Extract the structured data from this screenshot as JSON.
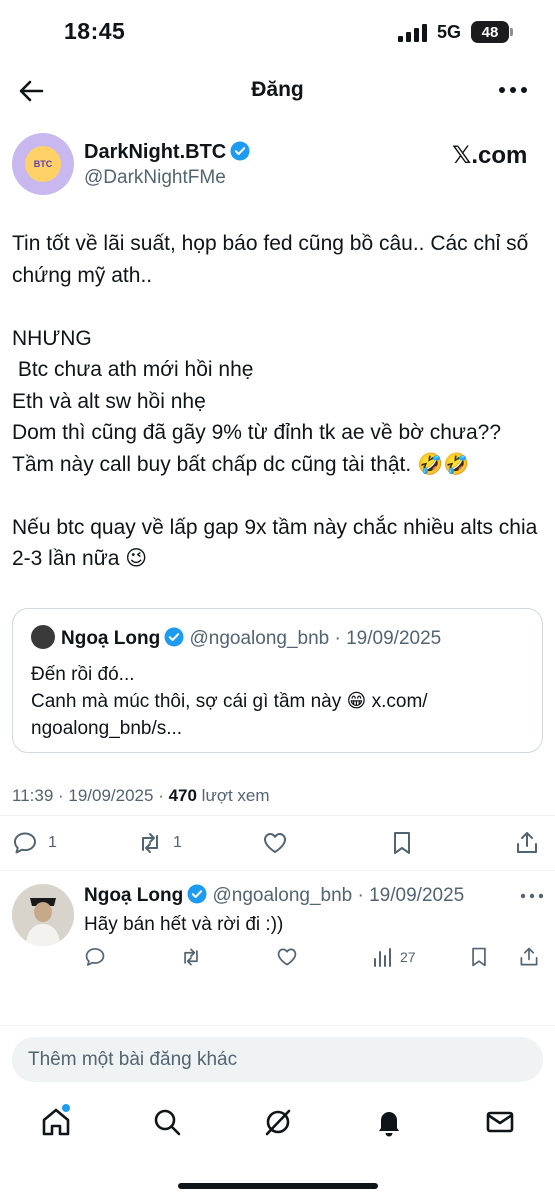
{
  "status_bar": {
    "time": "18:45",
    "network": "5G",
    "battery": "48"
  },
  "header": {
    "title": "Đăng"
  },
  "post": {
    "author_name": "DarkNight.BTC",
    "author_handle": "@DarkNightFMe",
    "avatar_text": "BTC",
    "source": "𝕏.com",
    "text": "Tin tốt về lãi suất, họp báo fed cũng bồ câu.. Các chỉ số chứng mỹ ath..\n\nNHƯNG\n Btc chưa ath mới hồi nhẹ\nEth và alt sw hồi nhẹ\nDom thì cũng đã gãy 9% từ đỉnh tk ae về bờ chưa??\nTầm này call buy bất chấp dc cũng tài thật. 🤣🤣\n\nNếu btc quay về lấp gap 9x tầm này chắc nhiều alts chia 2-3 lần nữa 😉",
    "quote": {
      "name": "Ngoạ Long",
      "meta": "@ngoalong_bnb · 19/09/2025",
      "text": "Đến rồi đó...\nCanh mà múc thôi, sợ cái gì tầm này 😁 x.com/\nngoalong_bnb/s..."
    },
    "timestamp": "11:39 · 19/09/2025 · ",
    "views_count": "470",
    "views_label": " lượt xem",
    "actions": {
      "replies": "1",
      "reposts": "1"
    }
  },
  "reply": {
    "name": "Ngoạ Long",
    "meta": "@ngoalong_bnb · 19/09/2025",
    "text": "Hãy bán hết và rời đi :))",
    "views": "27"
  },
  "compose": {
    "placeholder": "Thêm một bài đăng khác"
  },
  "colors": {
    "accent": "#1d9bf0",
    "muted": "#536471",
    "text": "#0f1419"
  }
}
